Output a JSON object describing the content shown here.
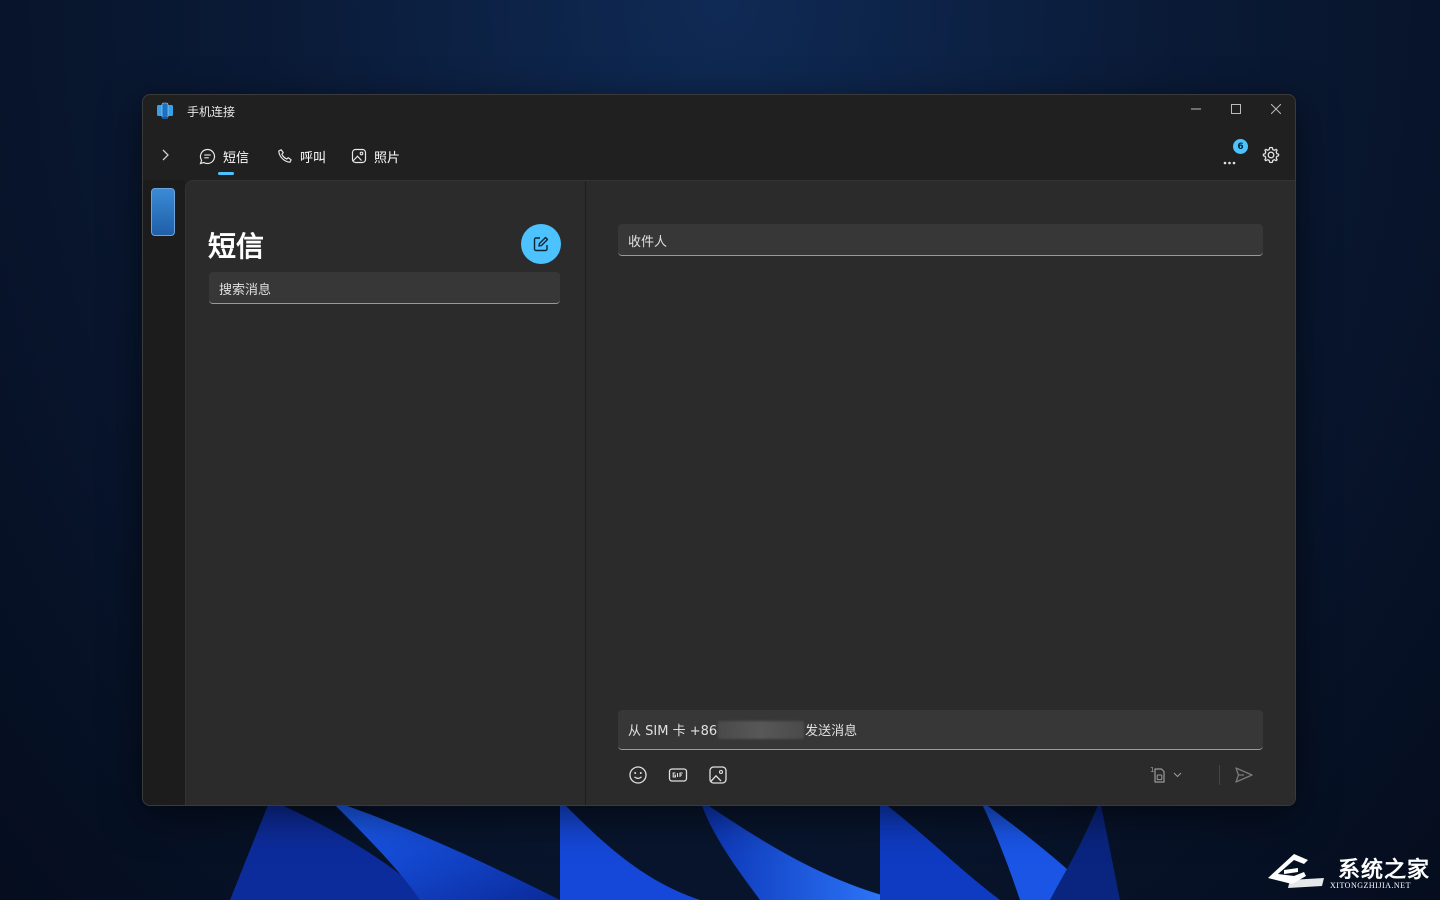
{
  "window": {
    "app_title": "手机连接"
  },
  "nav": {
    "tabs": [
      {
        "label": "短信"
      },
      {
        "label": "呼叫"
      },
      {
        "label": "照片"
      }
    ],
    "notification_count": "6"
  },
  "messages": {
    "title": "短信",
    "search_placeholder": "搜索消息"
  },
  "conversation": {
    "recipient_placeholder": "收件人",
    "composer_prefix": "从 SIM 卡 +86",
    "composer_suffix": "发送消息",
    "sim_slot": "1"
  },
  "watermark": {
    "name": "系统之家",
    "url": "XITONGZHIJIA.NET"
  },
  "colors": {
    "accent": "#4cc2ff",
    "window_bg": "#202020",
    "pane_bg": "#2b2b2b",
    "field_bg": "#373737"
  }
}
